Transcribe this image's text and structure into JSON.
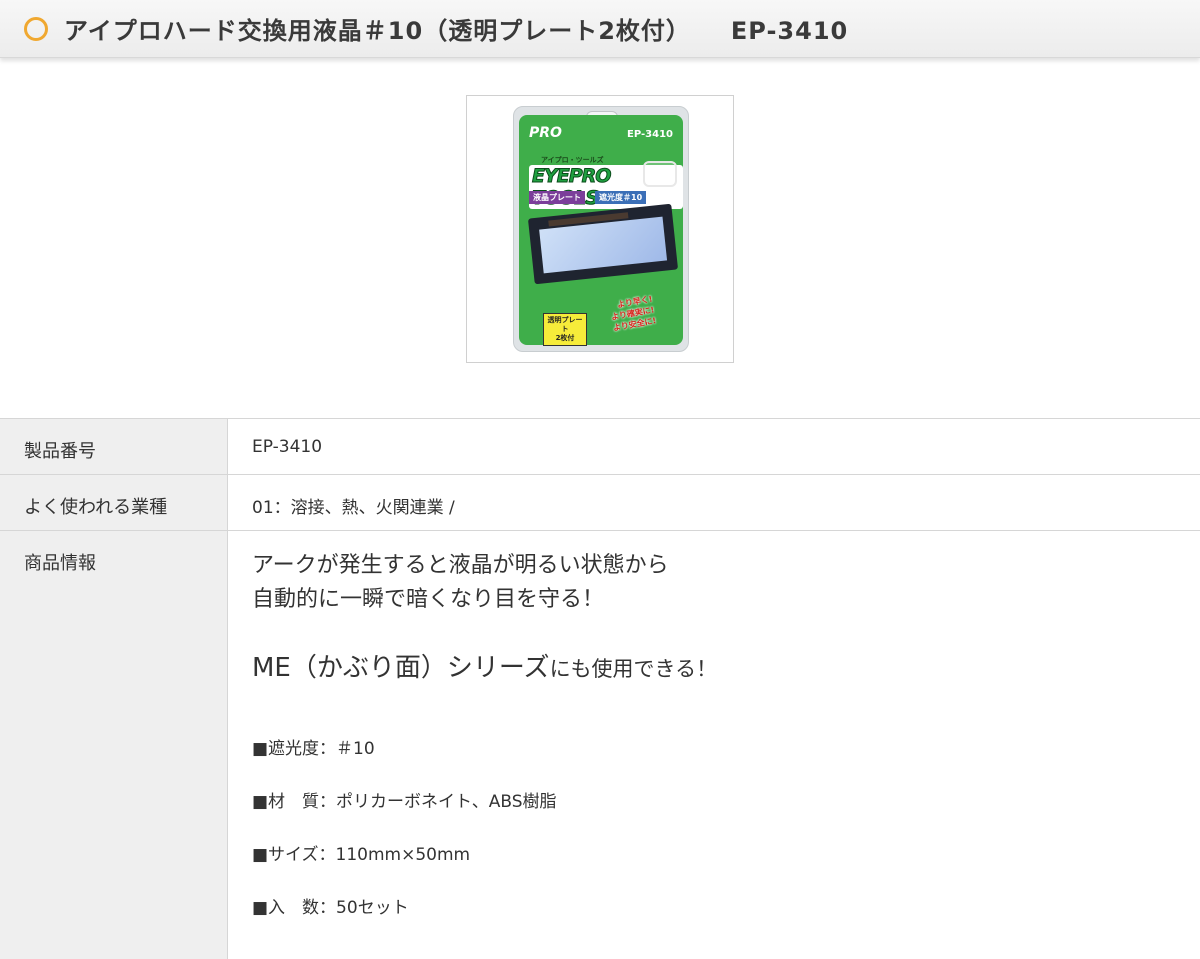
{
  "header": {
    "title": "アイプロハード交換用液晶＃10（透明プレート2枚付）",
    "code": "EP-3410"
  },
  "product_image": {
    "brand": "PRO",
    "code": "EP-3410",
    "subtitle": "アイプロ・ツールズ",
    "logo": "EYEPRO TOOLS",
    "tag_left": "液晶プレート",
    "tag_right": "遮光度＃10",
    "slogan_1": "より早く!",
    "slogan_2": "より確実に!",
    "slogan_3": "より安全に!",
    "note_1": "透明プレート",
    "note_2": "2枚付",
    "colors": {
      "package_green": "#3fae4a",
      "accent_orange": "#f0a830"
    }
  },
  "spec": {
    "rows": [
      {
        "label": "製品番号",
        "value": "EP-3410"
      },
      {
        "label": "よく使われる業種",
        "value": "01：溶接、熱、火関連業 /"
      },
      {
        "label": "商品情報"
      }
    ],
    "description": {
      "line1": "アークが発生すると液晶が明るい状態から",
      "line2": "自動的に一瞬で暗くなり目を守る！",
      "big": "ME（かぶり面）シリーズ",
      "small": "にも使用できる！",
      "items": [
        "■遮光度：＃10",
        "■材　質：ポリカーボネイト、ABS樹脂",
        "■サイズ：110mm×50mm",
        "■入　数：50セット"
      ]
    }
  }
}
